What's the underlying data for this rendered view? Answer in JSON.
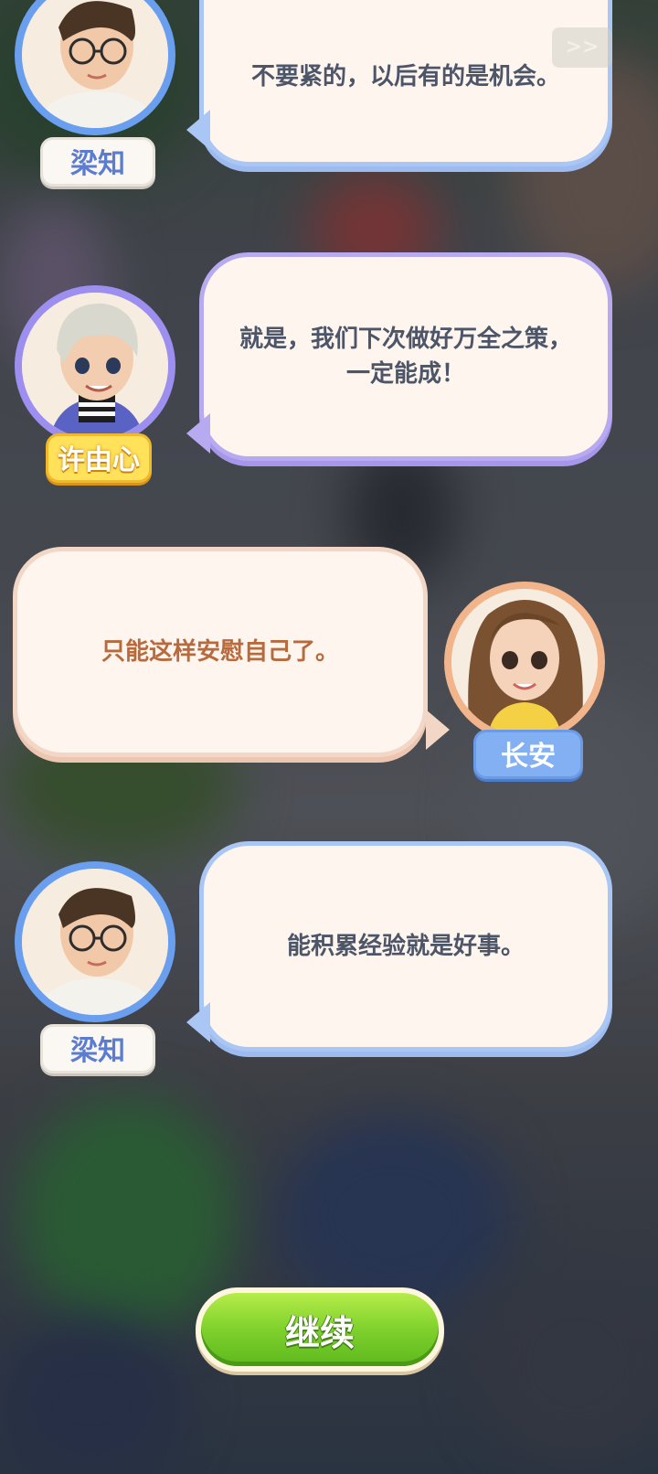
{
  "controls": {
    "skip_label": ">>",
    "continue_label": "继续"
  },
  "dialogue": [
    {
      "speaker": "梁知",
      "text": "不要紧的，以后有的是机会。",
      "side": "left",
      "accent": "#6a9ff0"
    },
    {
      "speaker": "许由心",
      "text": "就是，我们下次做好万全之策，一定能成！",
      "side": "left",
      "accent": "#9c8ff0"
    },
    {
      "speaker": "长安",
      "text": "只能这样安慰自己了。",
      "side": "right",
      "accent": "#f2b48a"
    },
    {
      "speaker": "梁知",
      "text": "能积累经验就是好事。",
      "side": "left",
      "accent": "#6a9ff0"
    }
  ],
  "colors": {
    "continue_green": "#7fd12c",
    "bubble_fill": "#fdf5ee"
  }
}
